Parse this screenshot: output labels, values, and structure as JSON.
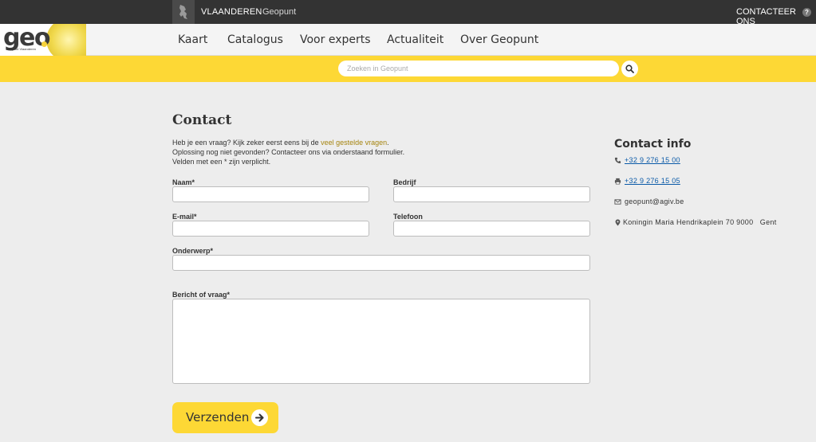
{
  "topbar": {
    "vlaanderen": "VLAANDEREN",
    "geopunt": "Geopunt",
    "contact": "CONTACTEER ONS",
    "help": "?"
  },
  "logo": {
    "text": "geo",
    "subtitle": "Geopunt Vlaanderen"
  },
  "nav": {
    "items": [
      "Kaart",
      "Catalogus",
      "Voor experts",
      "Actualiteit",
      "Over Geopunt"
    ]
  },
  "search": {
    "placeholder": "Zoeken in Geopunt",
    "icon": "search-icon"
  },
  "page": {
    "title": "Contact",
    "intro1_pre": "Heb je een vraag? Kijk zeker eerst eens bij de ",
    "intro1_link": "veel gestelde vragen",
    "intro1_post": ".",
    "intro2": "Oplossing nog niet gevonden? Contacteer ons via onderstaand formulier.",
    "intro3": "Velden met een * zijn verplicht."
  },
  "form": {
    "naam_label": "Naam*",
    "bedrijf_label": "Bedrijf",
    "email_label": "E-mail*",
    "telefoon_label": "Telefoon",
    "onderwerp_label": "Onderwerp*",
    "bericht_label": "Bericht of vraag*",
    "submit_label": "Verzenden"
  },
  "contact_info": {
    "title": "Contact info",
    "phone": "+32 9 276 15 00",
    "fax": "+32 9 276 15 05",
    "email": "geopunt@agiv.be",
    "address": "Koningin Maria Hendrikaplein 70 9000   Gent"
  },
  "colors": {
    "accent": "#fdd835",
    "topbar": "#333333",
    "link": "#a5840f"
  }
}
